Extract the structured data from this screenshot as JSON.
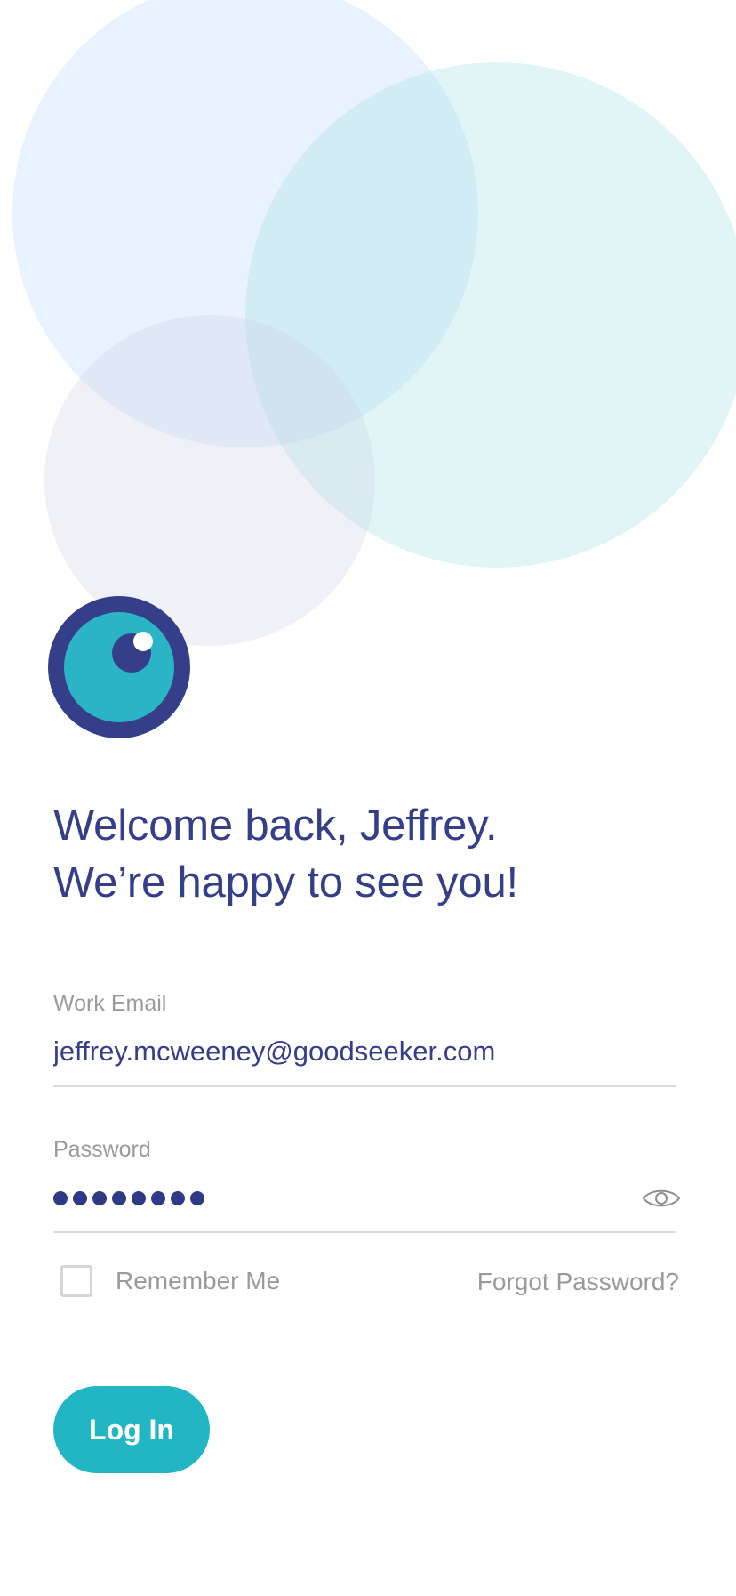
{
  "brand": {
    "logo_icon": "eye-logo-icon",
    "colors": {
      "navy": "#353e88",
      "teal": "#22b6c4"
    }
  },
  "welcome": {
    "line1": "Welcome back, Jeffrey.",
    "line2": "We’re happy to see you!"
  },
  "login_form": {
    "email": {
      "label": "Work Email",
      "value": "jeffrey.mcweeney@goodseeker.com"
    },
    "password": {
      "label": "Password",
      "masked_length": 8,
      "reveal_icon": "eye-icon"
    },
    "remember_me": {
      "label": "Remember Me",
      "checked": false
    },
    "forgot_password_label": "Forgot Password?",
    "submit_label": "Log In"
  }
}
